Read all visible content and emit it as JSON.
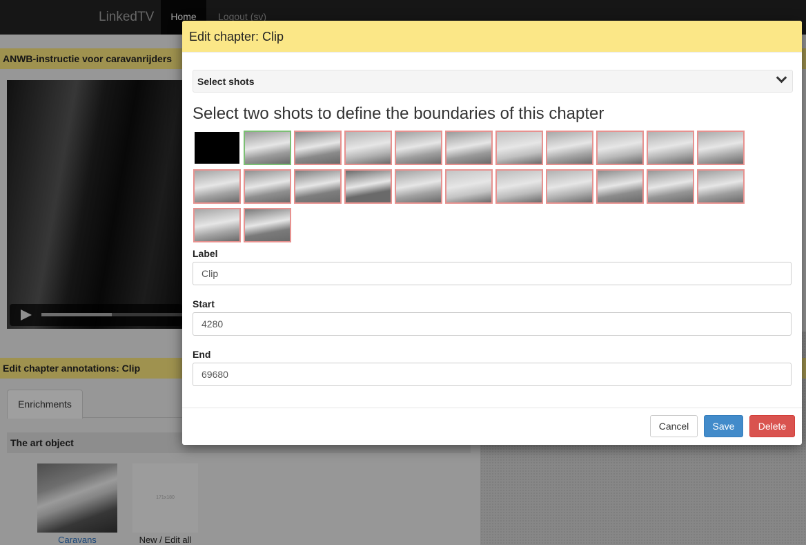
{
  "navbar": {
    "brand": "LinkedTV",
    "home": "Home",
    "logout": "Logout (sv)"
  },
  "video": {
    "title": "ANWB-instructie voor caravanrijders",
    "progress": 0.5
  },
  "chapter": {
    "title": "Edit chapter annotations: Clip"
  },
  "tabs": [
    {
      "label": "Enrichments"
    }
  ],
  "art_object": {
    "header": "The art object",
    "items": [
      {
        "caption": "Caravans"
      },
      {
        "caption": "New / Edit all",
        "placeholder": "171x180"
      }
    ]
  },
  "modal": {
    "title": "Edit chapter: Clip",
    "select_shots_label": "Select shots",
    "instruction": "Select two shots to define the boundaries of this chapter",
    "shots": [
      {
        "state": "black",
        "tone": "#000"
      },
      {
        "state": "selected",
        "tone": "#9c9c9c"
      },
      {
        "state": "normal",
        "tone": "#8a8a8a"
      },
      {
        "state": "normal",
        "tone": "#b4b4b4"
      },
      {
        "state": "normal",
        "tone": "#a0a0a0"
      },
      {
        "state": "normal",
        "tone": "#9a9a9a"
      },
      {
        "state": "normal",
        "tone": "#c0c0c0"
      },
      {
        "state": "normal",
        "tone": "#a8a8a8"
      },
      {
        "state": "normal",
        "tone": "#b8b8b8"
      },
      {
        "state": "normal",
        "tone": "#b0b0b0"
      },
      {
        "state": "normal",
        "tone": "#aaaaaa"
      },
      {
        "state": "normal",
        "tone": "#a4a4a4"
      },
      {
        "state": "normal",
        "tone": "#8f8f8f"
      },
      {
        "state": "normal",
        "tone": "#7e7e7e"
      },
      {
        "state": "normal",
        "tone": "#6a6a6a"
      },
      {
        "state": "normal",
        "tone": "#a2a2a2"
      },
      {
        "state": "normal",
        "tone": "#c4c4c4"
      },
      {
        "state": "normal",
        "tone": "#bcbcbc"
      },
      {
        "state": "normal",
        "tone": "#b2b2b2"
      },
      {
        "state": "normal",
        "tone": "#8c8c8c"
      },
      {
        "state": "normal",
        "tone": "#969696"
      },
      {
        "state": "normal",
        "tone": "#9e9e9e"
      },
      {
        "state": "normal",
        "tone": "#a6a6a6"
      },
      {
        "state": "normal",
        "tone": "#7a7a7a"
      }
    ],
    "fields": {
      "label": {
        "label": "Label",
        "value": "Clip"
      },
      "start": {
        "label": "Start",
        "value": "4280"
      },
      "end": {
        "label": "End",
        "value": "69680"
      }
    },
    "buttons": {
      "cancel": "Cancel",
      "save": "Save",
      "delete": "Delete"
    }
  },
  "colors": {
    "header_yellow": "#fbe787",
    "save_blue": "#428bca",
    "delete_red": "#d9534f",
    "shot_border": "#e7918f",
    "selected_border": "#7cbf74"
  }
}
